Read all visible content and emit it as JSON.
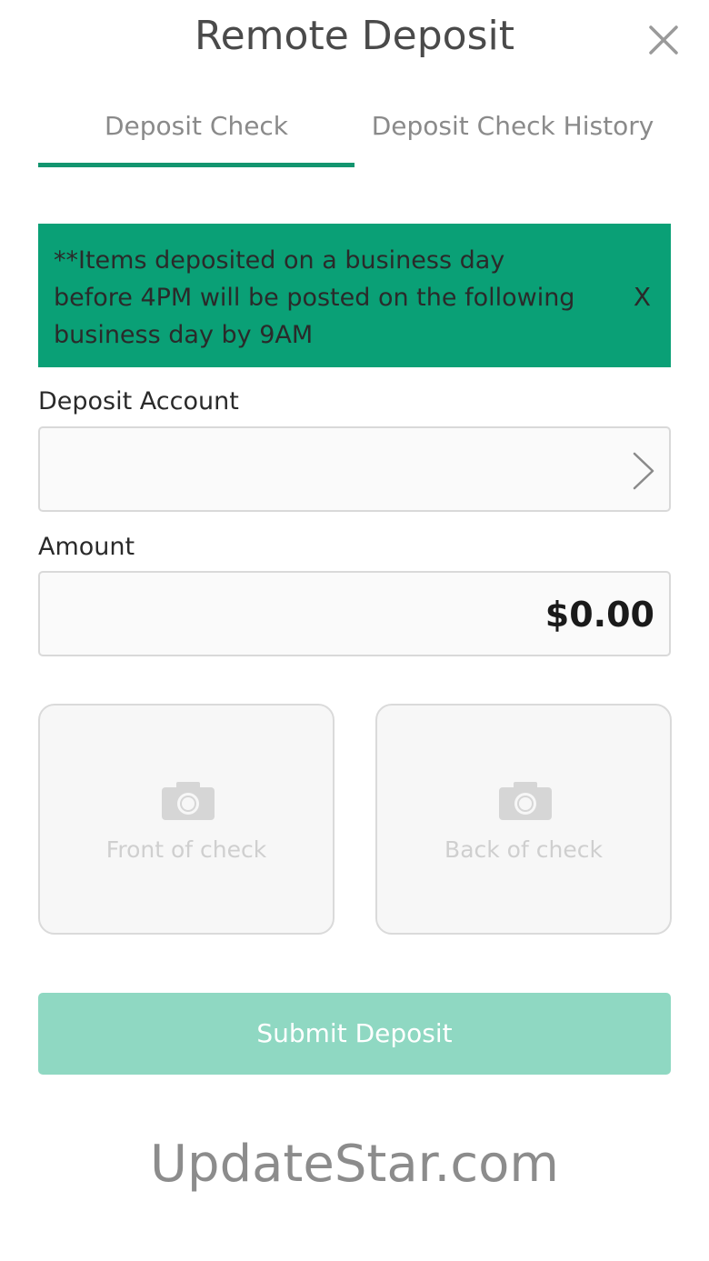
{
  "header": {
    "title": "Remote Deposit",
    "close_icon": "close-icon"
  },
  "tabs": [
    {
      "label": "Deposit Check",
      "active": true
    },
    {
      "label": "Deposit Check History",
      "active": false
    }
  ],
  "banner": {
    "message": "**Items deposited on a business day before 4PM will be posted on the following business day by 9AM",
    "dismiss_label": "X",
    "color": "#0aa076"
  },
  "deposit_account": {
    "label": "Deposit Account",
    "value": "",
    "icon": "chevron-right-icon"
  },
  "amount": {
    "label": "Amount",
    "value": "$0.00"
  },
  "check_images": {
    "front": {
      "label": "Front of check",
      "icon": "camera-icon"
    },
    "back": {
      "label": "Back of check",
      "icon": "camera-icon"
    }
  },
  "submit": {
    "label": "Submit Deposit",
    "enabled": false,
    "color": "#8fd8c2"
  },
  "watermark": {
    "text": "UpdateStar.com"
  },
  "colors": {
    "accent": "#13956f"
  }
}
